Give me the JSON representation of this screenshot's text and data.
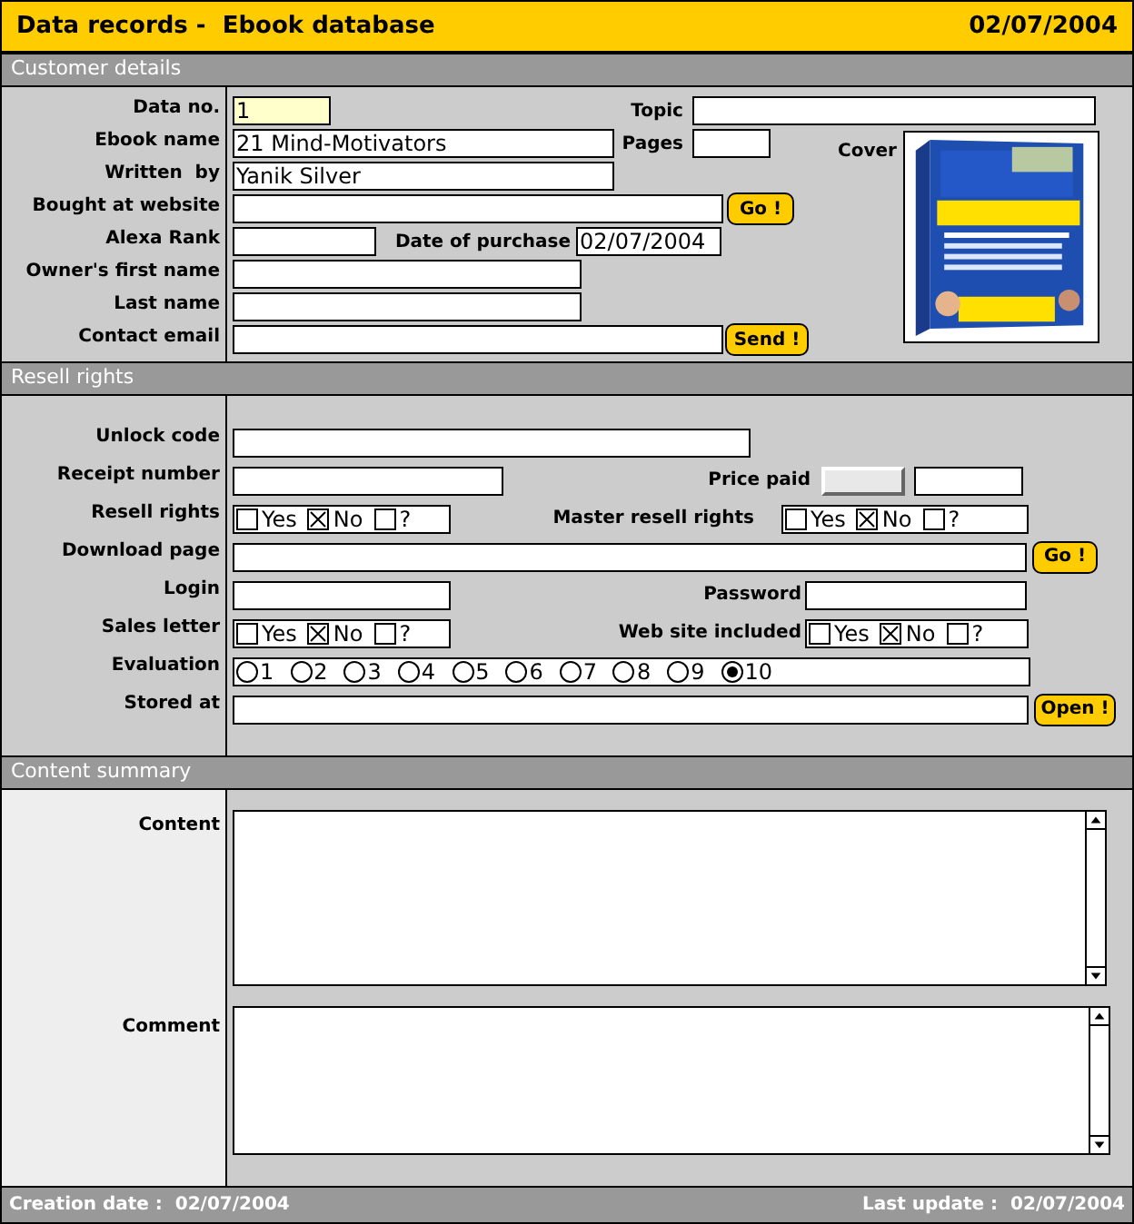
{
  "header": {
    "title": "Data records -  Ebook database",
    "date": "02/07/2004"
  },
  "customer_details": {
    "heading": "Customer details",
    "data_no": {
      "label": "Data no.",
      "value": "1"
    },
    "topic": {
      "label": "Topic"
    },
    "ebook_name": {
      "label": "Ebook name",
      "value": "21 Mind-Motivators"
    },
    "pages": {
      "label": "Pages"
    },
    "written_by": {
      "label": "Written  by",
      "value": "Yanik Silver"
    },
    "bought_at_website": {
      "label": "Bought at website",
      "button": "Go !"
    },
    "alexa_rank": {
      "label": "Alexa Rank"
    },
    "date_of_purchase": {
      "label": "Date of purchase",
      "value": "02/07/2004"
    },
    "owners_first_name": {
      "label": "Owner's first name"
    },
    "last_name": {
      "label": "Last name"
    },
    "contact_email": {
      "label": "Contact email",
      "button": "Send !"
    },
    "cover": {
      "label": "Cover",
      "kind": "picture"
    }
  },
  "resell_rights": {
    "heading": "Resell rights",
    "unlock_code": {
      "label": "Unlock code"
    },
    "receipt_number": {
      "label": "Receipt number"
    },
    "price_paid": {
      "label": "Price paid",
      "currency_disabled": true
    },
    "resell_rights": {
      "label": "Resell rights",
      "options": [
        {
          "label": "Yes",
          "checked": false
        },
        {
          "label": "No",
          "checked": true
        },
        {
          "label": "?",
          "checked": false
        }
      ]
    },
    "master_resell_rights": {
      "label": "Master resell rights",
      "options": [
        {
          "label": "Yes",
          "checked": false
        },
        {
          "label": "No",
          "checked": true
        },
        {
          "label": "?",
          "checked": false
        }
      ]
    },
    "download_page": {
      "label": "Download page",
      "button": "Go !"
    },
    "login": {
      "label": "Login"
    },
    "password": {
      "label": "Password"
    },
    "sales_letter": {
      "label": "Sales letter",
      "options": [
        {
          "label": "Yes",
          "checked": false
        },
        {
          "label": "No",
          "checked": true
        },
        {
          "label": "?",
          "checked": false
        }
      ]
    },
    "web_site_included": {
      "label": "Web site included",
      "options": [
        {
          "label": "Yes",
          "checked": false
        },
        {
          "label": "No",
          "checked": true
        },
        {
          "label": "?",
          "checked": false
        }
      ]
    },
    "evaluation": {
      "label": "Evaluation",
      "options": [
        {
          "label": "1",
          "selected": false
        },
        {
          "label": "2",
          "selected": false
        },
        {
          "label": "3",
          "selected": false
        },
        {
          "label": "4",
          "selected": false
        },
        {
          "label": "5",
          "selected": false
        },
        {
          "label": "6",
          "selected": false
        },
        {
          "label": "7",
          "selected": false
        },
        {
          "label": "8",
          "selected": false
        },
        {
          "label": "9",
          "selected": false
        },
        {
          "label": "10",
          "selected": true
        }
      ]
    },
    "stored_at": {
      "label": "Stored at",
      "button": "Open !"
    }
  },
  "content_summary": {
    "heading": "Content summary",
    "content": {
      "label": "Content"
    },
    "comment": {
      "label": "Comment"
    }
  },
  "footer": {
    "creation_date": "Creation date :  02/07/2004",
    "last_update": "Last update :  02/07/2004"
  }
}
